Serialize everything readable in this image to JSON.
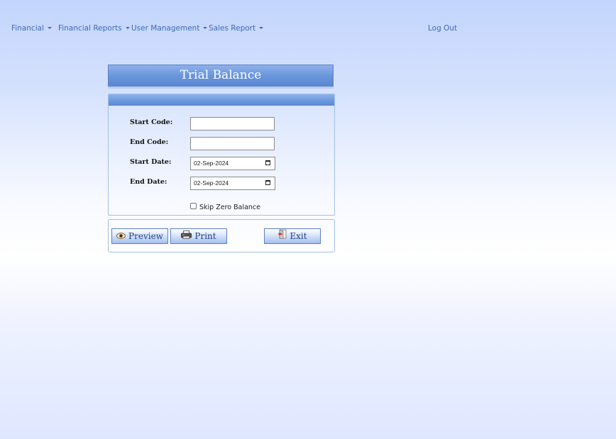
{
  "nav": {
    "financial": "Financial",
    "financial_reports": "Financial Reports",
    "user_management": "User Management",
    "sales_report": "Sales Report",
    "logout": "Log Out"
  },
  "page": {
    "title": "Trial Balance"
  },
  "form": {
    "start_code_label": "Start Code:",
    "start_code_value": "",
    "end_code_label": "End Code:",
    "end_code_value": "",
    "start_date_label": "Start Date:",
    "start_date_value": "02-Sep-2024",
    "end_date_label": "End Date:",
    "end_date_value": "02-Sep-2024",
    "skip_zero_label": "Skip Zero Balance",
    "skip_zero_checked": false
  },
  "buttons": {
    "preview": "Preview",
    "print": "Print",
    "exit": "Exit"
  },
  "icons": {
    "preview": "eye-icon",
    "print": "printer-icon",
    "exit": "exit-door-icon",
    "calendar": "calendar-icon",
    "dropdown": "caret-down-icon"
  },
  "colors": {
    "accent": "#5a87d2",
    "nav_text": "#3b6bb5",
    "button_text": "#1f3f8a"
  }
}
